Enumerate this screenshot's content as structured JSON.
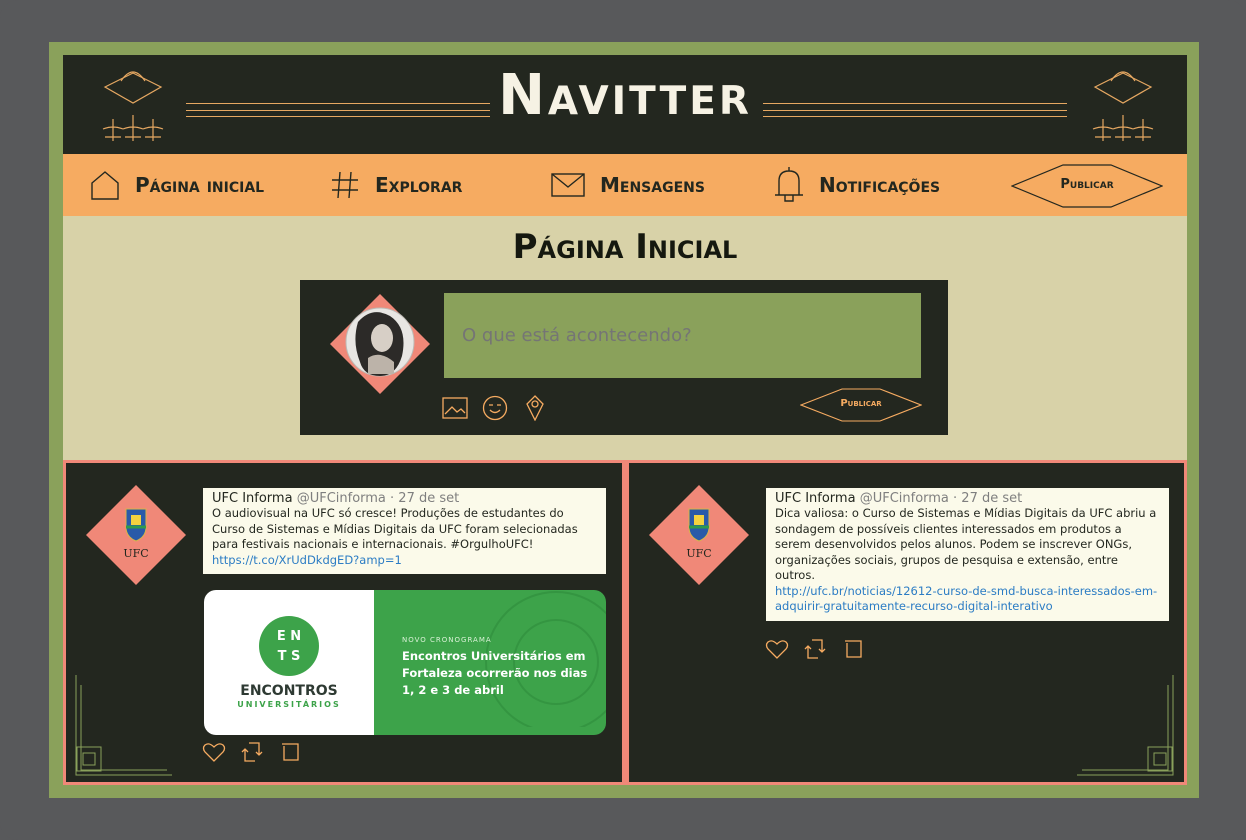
{
  "app": {
    "title": "Navitter"
  },
  "colors": {
    "dark": "#23271f",
    "orange": "#f6ab61",
    "olive": "#8aa15b",
    "cream": "#d8d2a8",
    "coral": "#f08878",
    "link": "#2b7cc4"
  },
  "nav": {
    "items": [
      {
        "label": "Página inicial",
        "icon": "home-icon"
      },
      {
        "label": "Explorar",
        "icon": "hash-icon"
      },
      {
        "label": "Mensagens",
        "icon": "envelope-icon"
      },
      {
        "label": "Notificações",
        "icon": "bell-icon"
      }
    ],
    "publish_label": "Publicar"
  },
  "page": {
    "title": "Página Inicial"
  },
  "composer": {
    "placeholder": "O que está acontecendo?",
    "tools": [
      "image-icon",
      "emoji-icon",
      "location-icon"
    ],
    "publish_label": "Publicar"
  },
  "feed": [
    {
      "author": "UFC Informa",
      "handle": "@UFCinforma",
      "date": "· 27 de set",
      "text": "O audiovisual na UFC só cresce! Produções de estudantes do Curso de Sistemas e Mídias Digitais da UFC foram selecionadas para festivais nacionais e internacionais. #OrgulhoUFC!",
      "link": "https://t.co/XrUdDkdgED?amp=1",
      "avatar_text": "UFC",
      "media": {
        "logo_text": "ENCONTROS",
        "logo_sub": "UNIVERSITÁRIOS",
        "kicker": "NOVO CRONOGRAMA",
        "headline": "Encontros Universitários em Fortaleza ocorrerão nos dias 1, 2 e 3 de abril"
      },
      "actions": [
        "heart-icon",
        "retweet-icon",
        "bookmark-icon"
      ]
    },
    {
      "author": "UFC Informa",
      "handle": "@UFCinforma",
      "date": "· 27 de set",
      "text": "Dica valiosa: o Curso de Sistemas e Mídias Digitais da UFC abriu a sondagem de possíveis clientes interessados em produtos a serem desenvolvidos pelos alunos. Podem se inscrever ONGs, organizações sociais, grupos de pesquisa e extensão, entre outros.",
      "link": "http://ufc.br/noticias/12612-curso-de-smd-busca-interessados-em-adquirir-gratuitamente-recurso-digital-interativo",
      "avatar_text": "UFC",
      "actions": [
        "heart-icon",
        "retweet-icon",
        "bookmark-icon"
      ]
    }
  ]
}
